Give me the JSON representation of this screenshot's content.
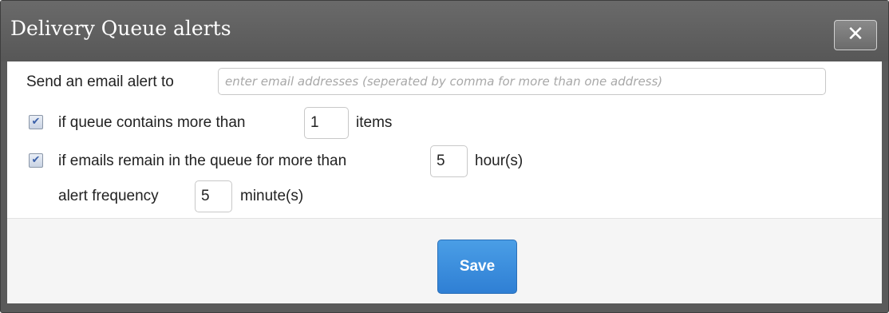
{
  "dialog": {
    "title": "Delivery Queue alerts",
    "close_label": "✕"
  },
  "email_alert": {
    "label": "Send an email alert to",
    "value": "",
    "placeholder": "enter email addresses (seperated by comma for more than one address)"
  },
  "queue_items_rule": {
    "checked": true,
    "prefix": "if queue contains more than",
    "value": "1",
    "suffix": "items"
  },
  "queue_time_rule": {
    "checked": true,
    "prefix": "if emails remain in the queue for more than",
    "value": "5",
    "suffix": "hour(s)"
  },
  "alert_frequency": {
    "label": "alert frequency",
    "value": "5",
    "suffix": "minute(s)"
  },
  "footer": {
    "save_label": "Save"
  },
  "icons": {
    "checkbox_checked": "✔"
  },
  "colors": {
    "titlebar": "#5a5a5a",
    "save_button": "#3a8ee0"
  }
}
